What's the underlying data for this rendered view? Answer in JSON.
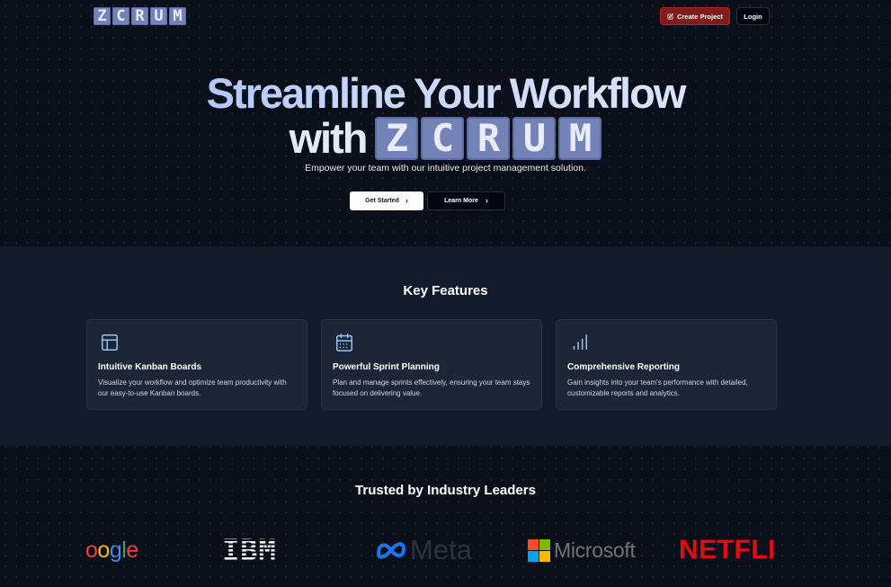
{
  "header": {
    "logo_letters": [
      "Z",
      "C",
      "R",
      "U",
      "M"
    ],
    "create_project_label": "Create Project",
    "login_label": "Login"
  },
  "hero": {
    "headline_line1": "Streamline Your Workflow",
    "headline_with": "with",
    "logo_letters": [
      "Z",
      "C",
      "R",
      "U",
      "M"
    ],
    "subtitle": "Empower your team with our intuitive project management solution.",
    "get_started_label": "Get Started",
    "learn_more_label": "Learn More"
  },
  "features": {
    "title": "Key Features",
    "cards": [
      {
        "icon": "layout-icon",
        "title": "Intuitive Kanban Boards",
        "description": "Visualize your workflow and optimize team productivity with our easy-to-use Kanban boards."
      },
      {
        "icon": "calendar-icon",
        "title": "Powerful Sprint Planning",
        "description": "Plan and manage sprints effectively, ensuring your team stays focused on delivering value."
      },
      {
        "icon": "bar-chart-icon",
        "title": "Comprehensive Reporting",
        "description": "Gain insights into your team's performance with detailed, customizable reports and analytics."
      }
    ]
  },
  "trusted": {
    "title": "Trusted by Industry Leaders",
    "logos": {
      "google": "oogle",
      "ibm": "IBM",
      "meta": "Meta",
      "microsoft": "Microsoft",
      "netflix": "NETFLIX"
    }
  },
  "colors": {
    "accent_red": "#7f1d1d",
    "logo_tile": "#7383b8",
    "icon_blue": "#93c5fd",
    "netflix_red": "#e50914"
  }
}
